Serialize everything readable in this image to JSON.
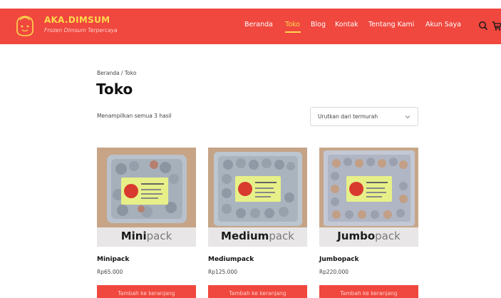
{
  "brand": {
    "name": "AKA.DIMSUM",
    "tagline": "Frozen Dimsum Terpercaya"
  },
  "nav": {
    "items": [
      "Beranda",
      "Toko",
      "Blog",
      "Kontak",
      "Tentang Kami",
      "Akun Saya"
    ],
    "active": "Toko"
  },
  "cart": {
    "count": "0"
  },
  "breadcrumb": "Beranda / Toko",
  "page_title": "Toko",
  "result_count": "Menampilkan semua 3 hasil",
  "sort": {
    "selected": "Urutkan dari termurah"
  },
  "products": [
    {
      "pack_bold": "Mini",
      "pack_light": "pack",
      "name": "Minipack",
      "price": "Rp65.000",
      "button": "Tambah ke keranjang"
    },
    {
      "pack_bold": "Medium",
      "pack_light": "pack",
      "name": "Mediumpack",
      "price": "Rp125.000",
      "button": "Tambah ke keranjang"
    },
    {
      "pack_bold": "Jumbo",
      "pack_light": "pack",
      "name": "Jumbopack",
      "price": "Rp220.000",
      "button": "Tambah ke keranjang"
    }
  ],
  "colors": {
    "brand_red": "#f0473e",
    "brand_yellow": "#ffd94d"
  }
}
